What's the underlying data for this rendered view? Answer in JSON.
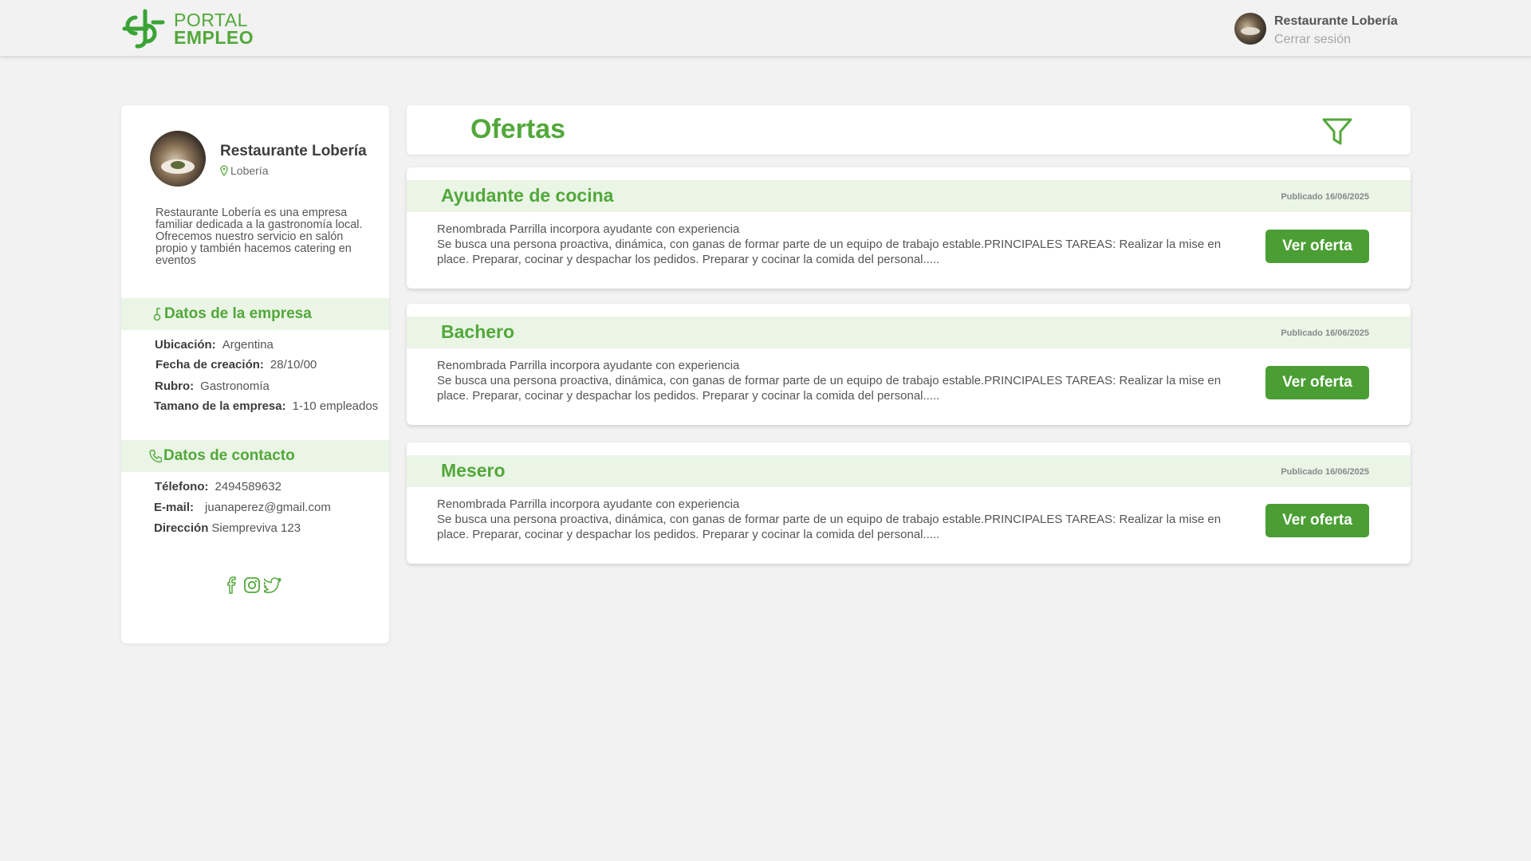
{
  "brand": {
    "line1": "PORTAL",
    "line2": "EMPLEO",
    "color": "#52a83a"
  },
  "header": {
    "user_name": "Restaurante Lobería",
    "logout_label": "Cerrar sesión"
  },
  "profile": {
    "name": "Restaurante Lobería",
    "location": "Lobería",
    "description": "Restaurante Lobería es una empresa familiar dedicada a la gastronomía local. Ofrecemos nuestro servicio en salón propio  y también hacemos catering en eventos",
    "company_section_title": "Datos de la empresa",
    "company": {
      "location_label": "Ubicación:",
      "location_value": "Argentina",
      "founded_label": "Fecha de creación:",
      "founded_value": "28/10/00",
      "industry_label": "Rubro:",
      "industry_value": "Gastronomía",
      "size_label": "Tamano de la empresa:",
      "size_value": "1-10 empleados"
    },
    "contact_section_title": "Datos de contacto",
    "contact": {
      "phone_label": "Télefono:",
      "phone_value": "2494589632",
      "email_label": "E-mail:",
      "email_value": "juanaperez@gmail.com",
      "address_label": "Dirección",
      "address_value": "Siempreviva 123"
    },
    "socials": [
      "facebook-icon",
      "instagram-icon",
      "twitter-icon"
    ]
  },
  "offers_title": "Ofertas",
  "offers": [
    {
      "title": "Ayudante de cocina",
      "date": "Publicado 16/06/2025",
      "subtitle": "Renombrada Parrilla incorpora ayudante con experiencia",
      "description": "Se busca una persona proactiva, dinámica, con ganas de formar parte de un equipo de trabajo estable.PRINCIPALES TAREAS: Realizar la mise en place. Preparar, cocinar y despachar los pedidos. Preparar y cocinar la comida del personal.....",
      "button": "Ver oferta"
    },
    {
      "title": "Bachero",
      "date": "Publicado 16/06/2025",
      "subtitle": "Renombrada Parrilla incorpora ayudante con experiencia",
      "description": "Se busca una persona proactiva, dinámica, con ganas de formar parte de un equipo de trabajo estable.PRINCIPALES TAREAS: Realizar la mise en place. Preparar, cocinar y despachar los pedidos. Preparar y cocinar la comida del personal.....",
      "button": "Ver oferta"
    },
    {
      "title": "Mesero",
      "date": "Publicado 16/06/2025",
      "subtitle": "Renombrada Parrilla incorpora ayudante con experiencia",
      "description": "Se busca una persona proactiva, dinámica, con ganas de formar parte de un equipo de trabajo estable.PRINCIPALES TAREAS: Realizar la mise en place. Preparar, cocinar y despachar los pedidos. Preparar y cocinar la comida del personal.....",
      "button": "Ver oferta"
    }
  ]
}
